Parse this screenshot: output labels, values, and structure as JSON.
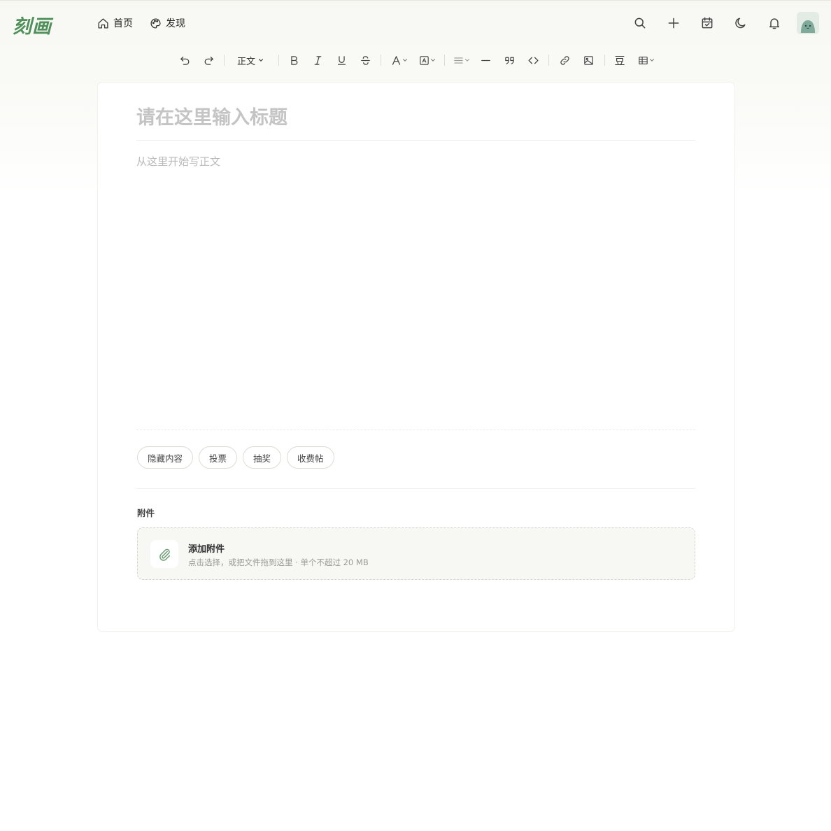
{
  "app": {
    "logo_text": "刻画",
    "brand_color": "#4f8f5a"
  },
  "nav": {
    "items": [
      {
        "label": "首页",
        "icon": "home-icon"
      },
      {
        "label": "发现",
        "icon": "palette-icon"
      }
    ]
  },
  "header": {
    "icons": [
      "search-icon",
      "plus-icon",
      "calendar-check-icon",
      "moon-icon",
      "bell-icon"
    ],
    "avatar": "avatar"
  },
  "toolbar": {
    "paragraph_style": "正文",
    "icons": [
      "undo-icon",
      "redo-icon",
      "bold-icon",
      "italic-icon",
      "underline-icon",
      "strikethrough-icon",
      "font-color-icon",
      "highlight-icon",
      "align-icon",
      "horizontal-rule-icon",
      "quote-icon",
      "code-icon",
      "link-icon",
      "image-icon",
      "douban-icon",
      "table-icon"
    ],
    "douban_label": "豆"
  },
  "editor": {
    "title_placeholder": "请在这里输入标题",
    "body_placeholder": "从这里开始写正文"
  },
  "chips": [
    "隐藏内容",
    "投票",
    "抽奖",
    "收费帖"
  ],
  "attachment": {
    "section_label": "附件",
    "title": "添加附件",
    "description": "点击选择，或把文件拖到这里 · 单个不超过 20 MB"
  }
}
